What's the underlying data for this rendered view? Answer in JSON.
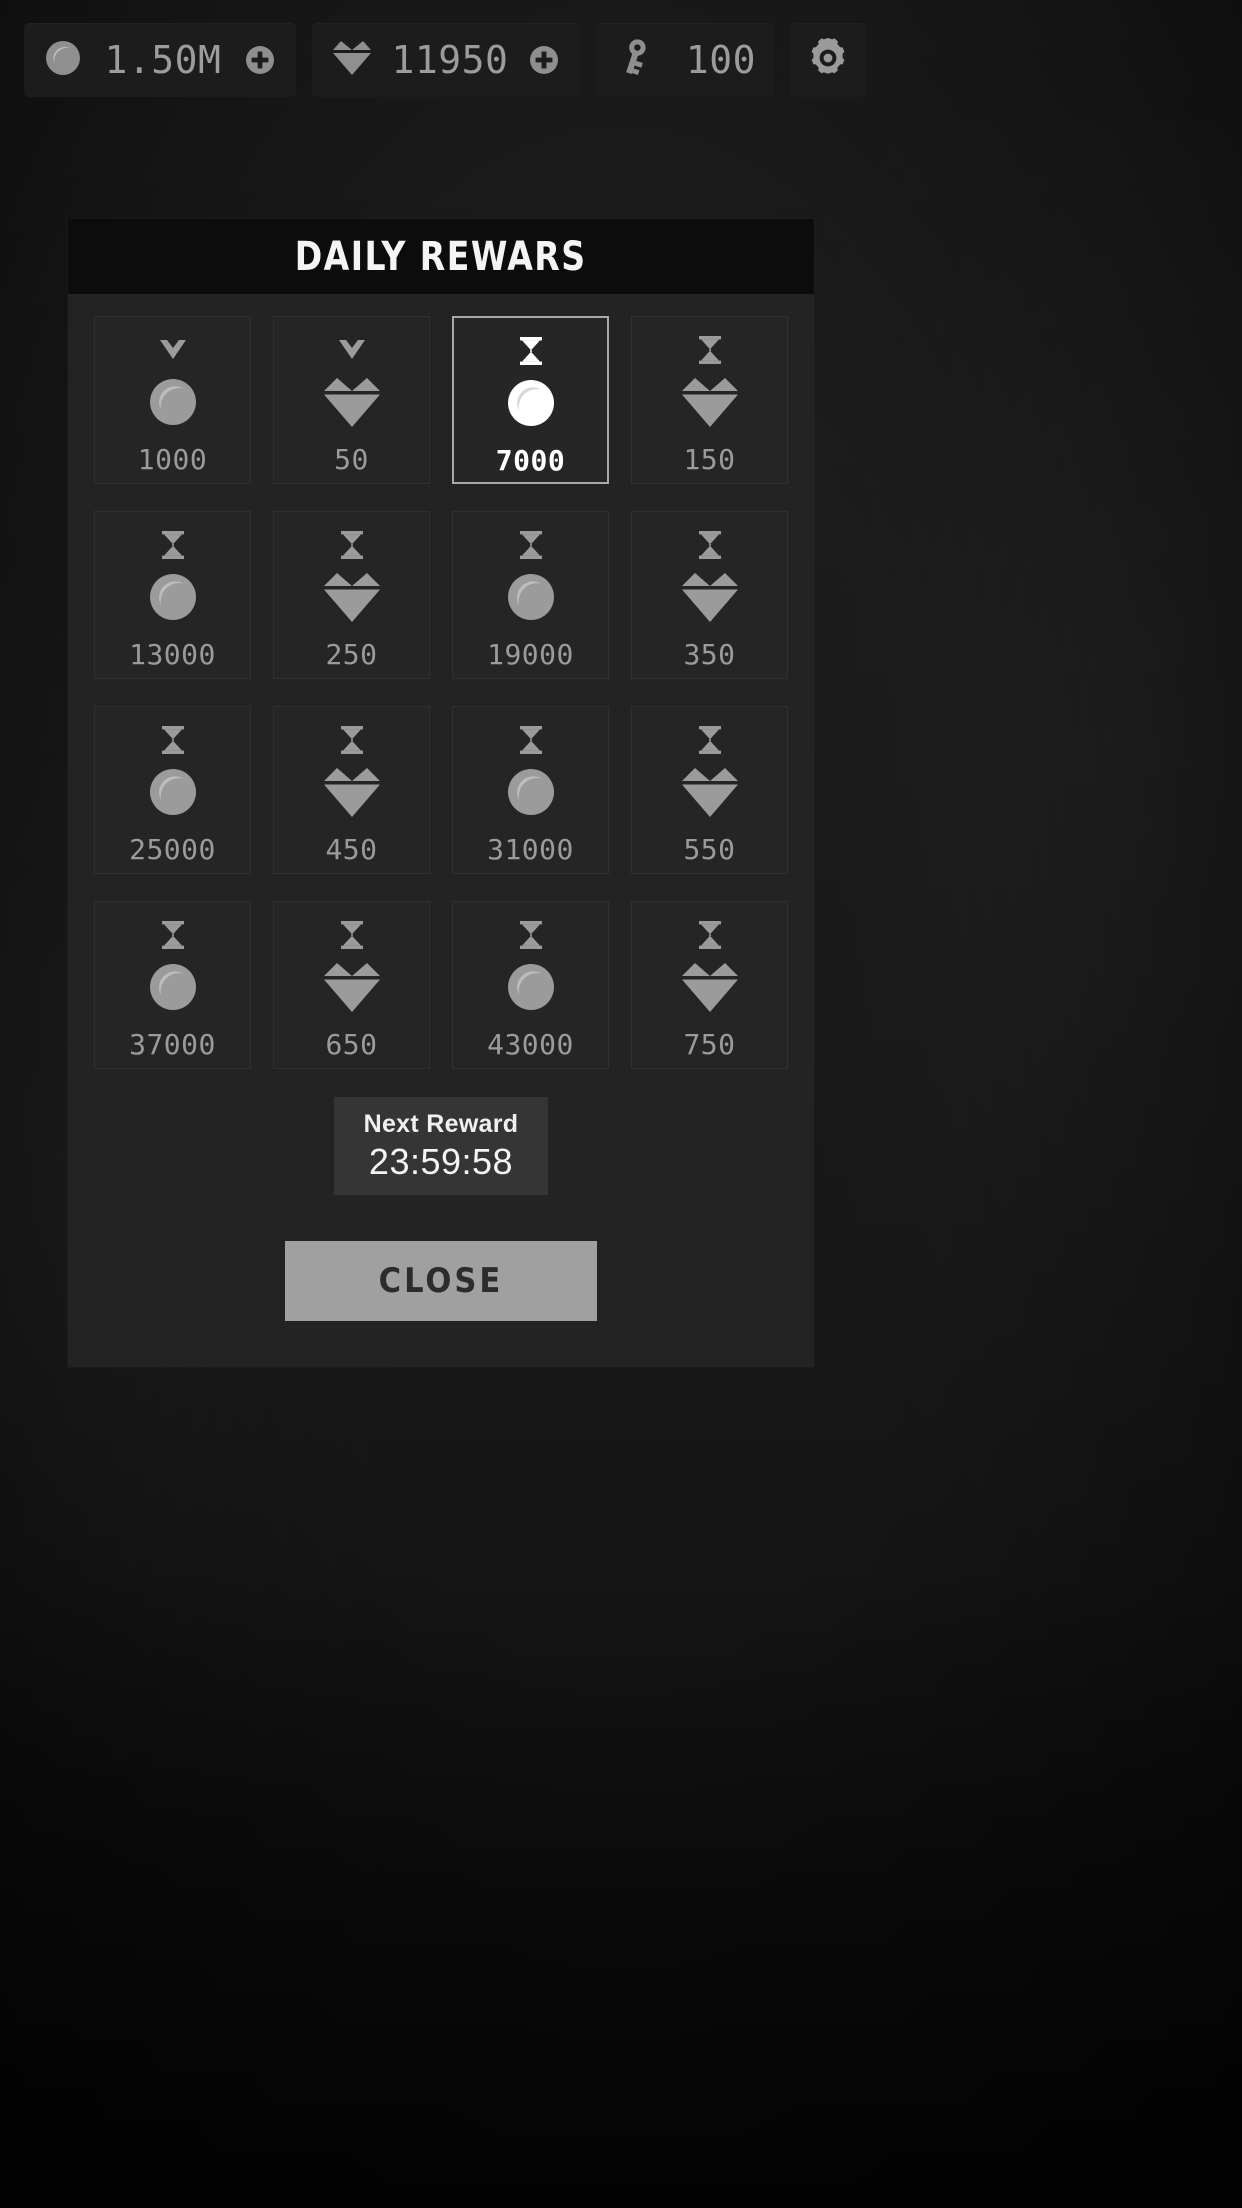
{
  "topbar": {
    "resources": [
      {
        "id": "coins",
        "icon": "coin-icon",
        "value": "1.50M",
        "has_plus": true,
        "plus_icon": "plus-circle-icon"
      },
      {
        "id": "gems",
        "icon": "gem-icon",
        "value": "11950",
        "has_plus": true,
        "plus_icon": "plus-circle-icon"
      },
      {
        "id": "keys",
        "icon": "key-icon",
        "value": "100",
        "has_plus": false,
        "plus_icon": ""
      }
    ],
    "settings": {
      "id": "settings",
      "icon": "gear-icon",
      "label": "Settings"
    }
  },
  "modal": {
    "title": "DAILY REWARS",
    "rewards": [
      {
        "amount": "1000",
        "currency": "coin",
        "state": "claimed",
        "status_icon": "check-icon"
      },
      {
        "amount": "50",
        "currency": "gem",
        "state": "claimed",
        "status_icon": "check-icon"
      },
      {
        "amount": "7000",
        "currency": "coin",
        "state": "available",
        "status_icon": "hourglass-icon"
      },
      {
        "amount": "150",
        "currency": "gem",
        "state": "locked",
        "status_icon": "hourglass-icon"
      },
      {
        "amount": "13000",
        "currency": "coin",
        "state": "locked",
        "status_icon": "hourglass-icon"
      },
      {
        "amount": "250",
        "currency": "gem",
        "state": "locked",
        "status_icon": "hourglass-icon"
      },
      {
        "amount": "19000",
        "currency": "coin",
        "state": "locked",
        "status_icon": "hourglass-icon"
      },
      {
        "amount": "350",
        "currency": "gem",
        "state": "locked",
        "status_icon": "hourglass-icon"
      },
      {
        "amount": "25000",
        "currency": "coin",
        "state": "locked",
        "status_icon": "hourglass-icon"
      },
      {
        "amount": "450",
        "currency": "gem",
        "state": "locked",
        "status_icon": "hourglass-icon"
      },
      {
        "amount": "31000",
        "currency": "coin",
        "state": "locked",
        "status_icon": "hourglass-icon"
      },
      {
        "amount": "550",
        "currency": "gem",
        "state": "locked",
        "status_icon": "hourglass-icon"
      },
      {
        "amount": "37000",
        "currency": "coin",
        "state": "locked",
        "status_icon": "hourglass-icon"
      },
      {
        "amount": "650",
        "currency": "gem",
        "state": "locked",
        "status_icon": "hourglass-icon"
      },
      {
        "amount": "43000",
        "currency": "coin",
        "state": "locked",
        "status_icon": "hourglass-icon"
      },
      {
        "amount": "750",
        "currency": "gem",
        "state": "locked",
        "status_icon": "hourglass-icon"
      }
    ],
    "next_reward": {
      "label": "Next Reward",
      "time": "23:59:58"
    },
    "close_label": "CLOSE"
  },
  "colors": {
    "modal_bg": "#232323",
    "header_bg": "#0c0c0c",
    "cell_bg": "#252525",
    "cell_border": "#303030",
    "active_border": "#a8a8a8",
    "icon_dim": "#9b9b9b",
    "icon_active": "#ffffff",
    "text_dim": "#9b9b9b",
    "text_bright": "#f4f4f4",
    "timer_bg": "#353535",
    "close_bg": "#a0a0a0",
    "close_text": "#2c2c2c"
  }
}
